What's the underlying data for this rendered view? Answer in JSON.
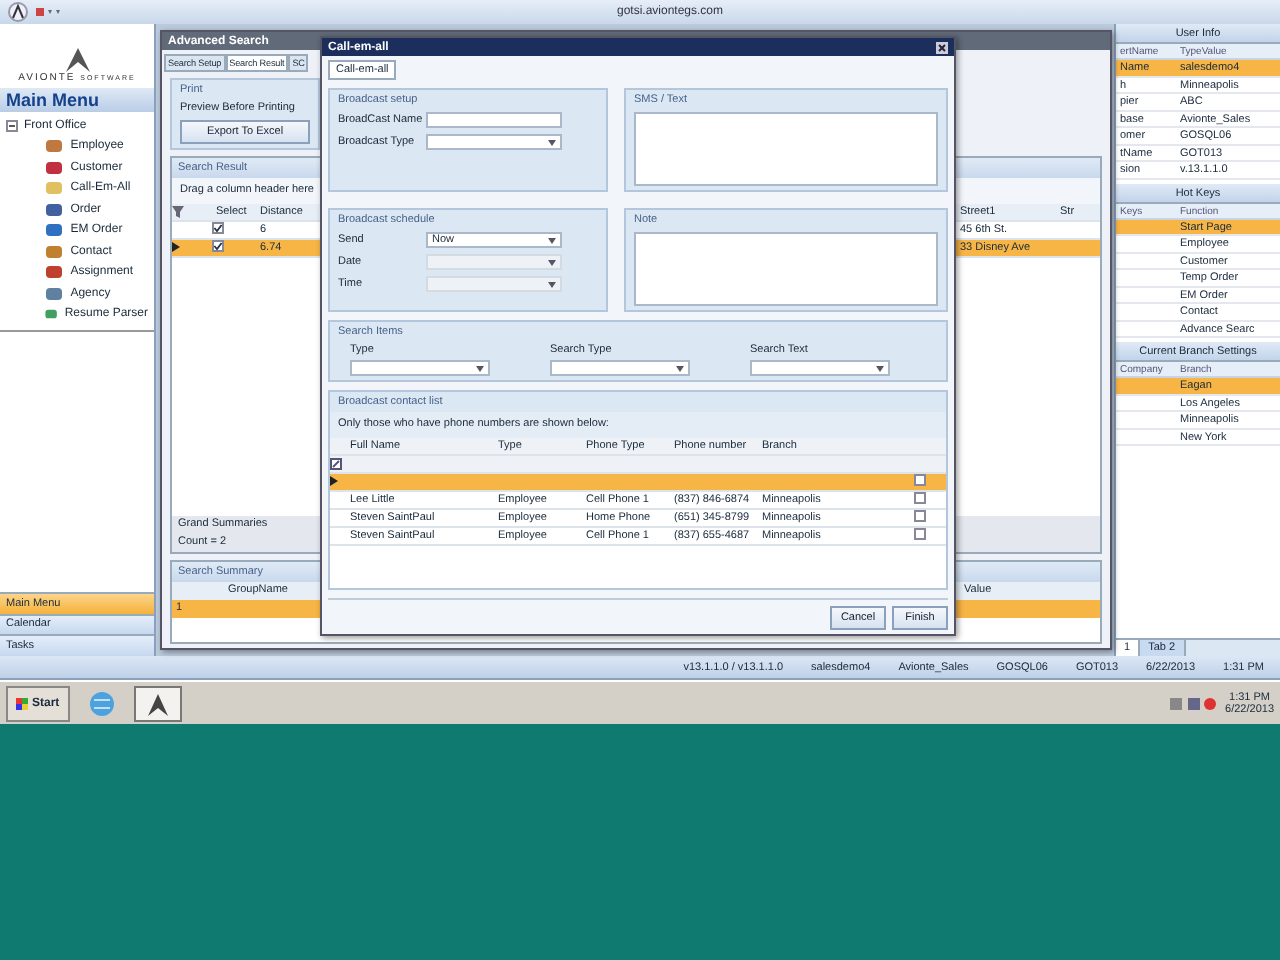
{
  "app": {
    "title": "gotsi.aviontegs.com"
  },
  "logo": {
    "name": "AVIONTE",
    "tag": "SOFTWARE"
  },
  "main_menu": {
    "title": "Main Menu",
    "tree": [
      {
        "label": "Front Office",
        "expanded": true,
        "children": [
          {
            "label": "Employee",
            "color": "#c07840"
          },
          {
            "label": "Customer",
            "color": "#c03040"
          },
          {
            "label": "Call-Em-All",
            "color": "#e0c060"
          },
          {
            "label": "Order",
            "color": "#4060a0"
          },
          {
            "label": "EM Order",
            "color": "#3070c0"
          },
          {
            "label": "Contact",
            "color": "#c08030"
          },
          {
            "label": "Assignment",
            "color": "#c04030"
          },
          {
            "label": "Agency",
            "color": "#6080a0"
          },
          {
            "label": "Resume Parser",
            "color": "#40a060"
          }
        ]
      }
    ]
  },
  "nav_buttons": [
    {
      "label": "Main Menu",
      "selected": true
    },
    {
      "label": "Calendar",
      "selected": false
    },
    {
      "label": "Tasks",
      "selected": false
    }
  ],
  "advanced_search": {
    "title": "Advanced Search",
    "tabs": [
      {
        "label": "Search Setup",
        "selected": false
      },
      {
        "label": "Search Result",
        "selected": true
      },
      {
        "label": "SC",
        "selected": false
      }
    ],
    "print": {
      "title": "Print",
      "option": "Preview Before Printing",
      "button": "Export To Excel"
    },
    "search_result": {
      "title": "Search Result",
      "group_hint": "Drag a column header here",
      "columns": [
        "Select",
        "Distance",
        "Street1",
        "Str"
      ],
      "rows": [
        {
          "checked": true,
          "distance": "6",
          "street": "45 6th St.",
          "selected": false
        },
        {
          "checked": true,
          "distance": "6.74",
          "street": "33 Disney Ave",
          "selected": true
        }
      ],
      "summary_label": "Grand Summaries",
      "count": "Count = 2"
    },
    "search_summary": {
      "title": "Search Summary",
      "columns": [
        "GroupName",
        "Value"
      ],
      "rows": [
        {
          "group": "1",
          "selected": true
        }
      ]
    }
  },
  "dialog": {
    "title": "Call-em-all",
    "tab": "Call-em-all",
    "broadcast_setup": {
      "title": "Broadcast setup",
      "fields": [
        {
          "label": "BroadCast Name",
          "kind": "text"
        },
        {
          "label": "Broadcast Type",
          "kind": "dropdown"
        }
      ]
    },
    "sms": {
      "title": "SMS / Text"
    },
    "schedule": {
      "title": "Broadcast schedule",
      "fields": [
        {
          "label": "Send",
          "value": "Now",
          "disabled": false
        },
        {
          "label": "Date",
          "disabled": true
        },
        {
          "label": "Time",
          "disabled": true
        }
      ]
    },
    "note": {
      "title": "Note"
    },
    "search_items": {
      "title": "Search Items",
      "fields": [
        "Type",
        "Search Type",
        "Search Text"
      ]
    },
    "contact_list": {
      "title": "Broadcast contact list",
      "hint": "Only those who have phone numbers are shown below:",
      "columns": [
        "Full Name",
        "Type",
        "Phone Type",
        "Phone number",
        "Branch"
      ],
      "rows": [
        {
          "cells": [],
          "selected": true,
          "checked": false
        },
        {
          "cells": [
            "Lee Little",
            "Employee",
            "Cell Phone 1",
            "(837) 846-6874",
            "Minneapolis"
          ],
          "selected": false,
          "checked": false
        },
        {
          "cells": [
            "Steven SaintPaul",
            "Employee",
            "Home Phone",
            "(651) 345-8799",
            "Minneapolis"
          ],
          "selected": false,
          "checked": false
        },
        {
          "cells": [
            "Steven SaintPaul",
            "Employee",
            "Cell Phone 1",
            "(837) 655-4687",
            "Minneapolis"
          ],
          "selected": false,
          "checked": false
        }
      ]
    },
    "buttons": [
      "Cancel",
      "Finish"
    ]
  },
  "user_info": {
    "title": "User Info",
    "columns": [
      "ertName",
      "TypeValue"
    ],
    "rows": [
      {
        "cells": [
          "Name",
          "salesdemo4"
        ],
        "selected": true
      },
      {
        "cells": [
          "h",
          "Minneapolis"
        ],
        "selected": false
      },
      {
        "cells": [
          "pier",
          "ABC"
        ],
        "selected": false
      },
      {
        "cells": [
          "base",
          "Avionte_Sales"
        ],
        "selected": false
      },
      {
        "cells": [
          "omer",
          "GOSQL06"
        ],
        "selected": false
      },
      {
        "cells": [
          "tName",
          "GOT013"
        ],
        "selected": false
      },
      {
        "cells": [
          "sion",
          "v.13.1.1.0"
        ],
        "selected": false
      }
    ]
  },
  "hot_keys": {
    "title": "Hot Keys",
    "columns": [
      "Keys",
      "Function"
    ],
    "rows": [
      {
        "cells": [
          "",
          "Start Page"
        ],
        "selected": true
      },
      {
        "cells": [
          "",
          "Employee"
        ],
        "selected": false
      },
      {
        "cells": [
          "",
          "Customer"
        ],
        "selected": false
      },
      {
        "cells": [
          "",
          "Temp Order"
        ],
        "selected": false
      },
      {
        "cells": [
          "",
          "EM Order"
        ],
        "selected": false
      },
      {
        "cells": [
          "",
          "Contact"
        ],
        "selected": false
      },
      {
        "cells": [
          "",
          "Advance Searc"
        ],
        "selected": false
      }
    ]
  },
  "branch_settings": {
    "title": "Current Branch Settings",
    "columns": [
      "Company",
      "Branch"
    ],
    "rows": [
      {
        "cells": [
          "",
          "Eagan"
        ],
        "selected": true
      },
      {
        "cells": [
          "",
          "Los Angeles"
        ],
        "selected": false
      },
      {
        "cells": [
          "",
          "Minneapolis"
        ],
        "selected": false
      },
      {
        "cells": [
          "",
          "New York"
        ],
        "selected": false
      }
    ]
  },
  "right_tabs": [
    {
      "label": "1",
      "selected": true
    },
    {
      "label": "Tab 2",
      "selected": false
    }
  ],
  "status_bar": [
    "v13.1.1.0 / v13.1.1.0",
    "salesdemo4",
    "Avionte_Sales",
    "GOSQL06",
    "GOT013",
    "6/22/2013",
    "1:31 PM"
  ],
  "taskbar": {
    "start": "Start",
    "time": "1:31 PM",
    "date": "6/22/2013"
  }
}
